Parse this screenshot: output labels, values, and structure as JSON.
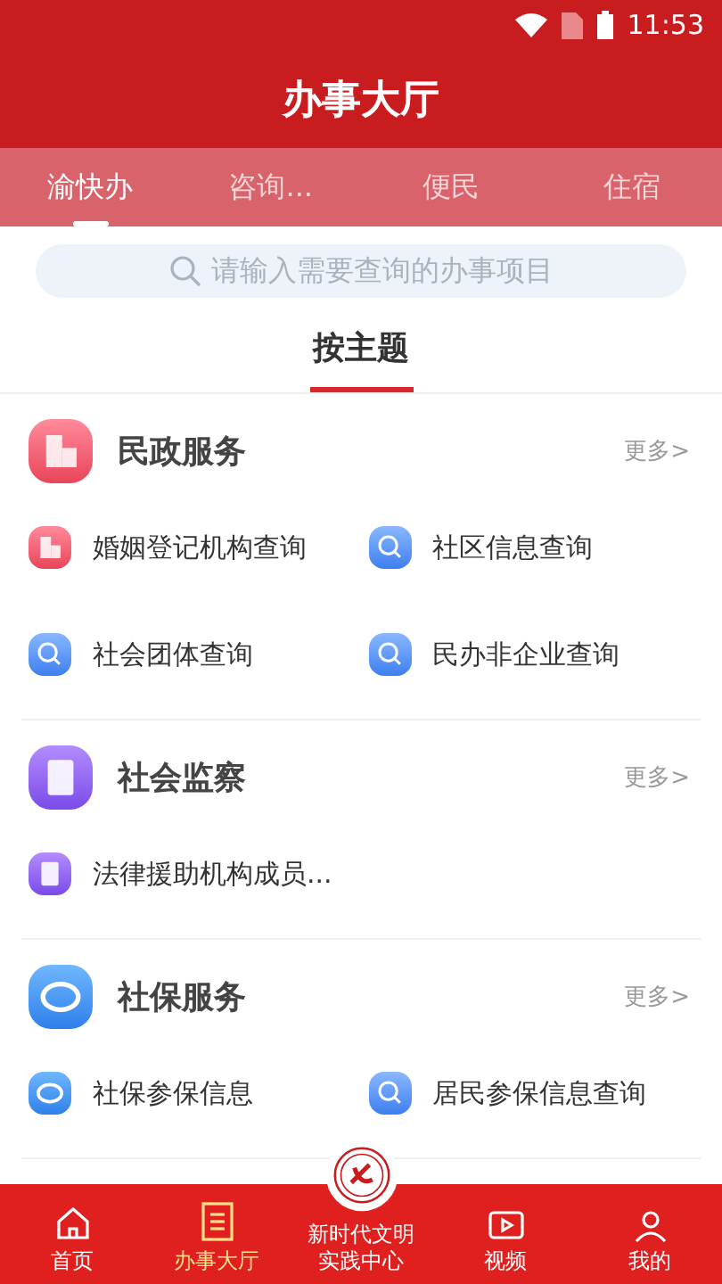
{
  "status_bar": {
    "time": "11:53"
  },
  "header": {
    "title": "办事大厅"
  },
  "tabs": [
    {
      "label": "渝快办",
      "selected": true
    },
    {
      "label": "咨询...",
      "selected": false
    },
    {
      "label": "便民",
      "selected": false
    },
    {
      "label": "住宿",
      "selected": false
    }
  ],
  "search": {
    "placeholder": "请输入需要查询的办事项目"
  },
  "topic_tab": {
    "label": "按主题",
    "selected": true
  },
  "sections": [
    {
      "title": "民政服务",
      "more": "更多>",
      "items": [
        {
          "label": "婚姻登记机构查询"
        },
        {
          "label": "社区信息查询"
        },
        {
          "label": "社会团体查询"
        },
        {
          "label": "民办非企业查询"
        }
      ]
    },
    {
      "title": "社会监察",
      "more": "更多>",
      "items": [
        {
          "label": "法律援助机构成员..."
        }
      ]
    },
    {
      "title": "社保服务",
      "more": "更多>",
      "items": [
        {
          "label": "社保参保信息"
        },
        {
          "label": "居民参保信息查询"
        }
      ]
    }
  ],
  "bottom_nav": [
    {
      "label": "首页",
      "selected": false
    },
    {
      "label": "办事大厅",
      "selected": true
    },
    {
      "label": "新时代文明实践中心",
      "selected": false
    },
    {
      "label": "视频",
      "selected": false
    },
    {
      "label": "我的",
      "selected": false
    }
  ]
}
